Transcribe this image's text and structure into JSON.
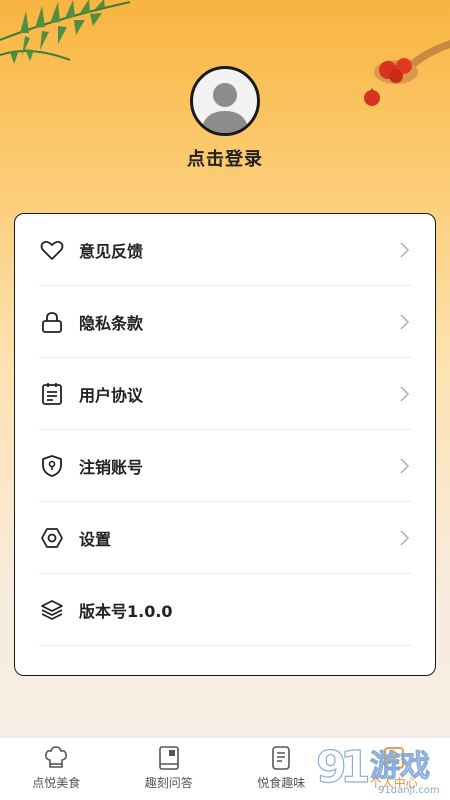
{
  "profile": {
    "login_label": "点击登录"
  },
  "menu": [
    {
      "label": "意见反馈",
      "icon": "heart-icon"
    },
    {
      "label": "隐私条款",
      "icon": "lock-icon"
    },
    {
      "label": "用户协议",
      "icon": "document-icon"
    },
    {
      "label": "注销账号",
      "icon": "shield-icon"
    },
    {
      "label": "设置",
      "icon": "hexagon-settings-icon"
    },
    {
      "label": "版本号1.0.0",
      "icon": "layers-icon"
    }
  ],
  "tabs": [
    {
      "label": "点悦美食",
      "icon": "chef-hat-icon"
    },
    {
      "label": "趣刻问答",
      "icon": "book-icon"
    },
    {
      "label": "悦食趣味",
      "icon": "notes-icon"
    },
    {
      "label": "个人中心",
      "icon": "profile-icon"
    }
  ],
  "watermark": {
    "brand": "游戏",
    "number": "9",
    "site": "91danji.com"
  },
  "colors": {
    "accent": "#e8903a",
    "gradient_top": "#f9b441",
    "gradient_bottom": "#f7eee6"
  }
}
